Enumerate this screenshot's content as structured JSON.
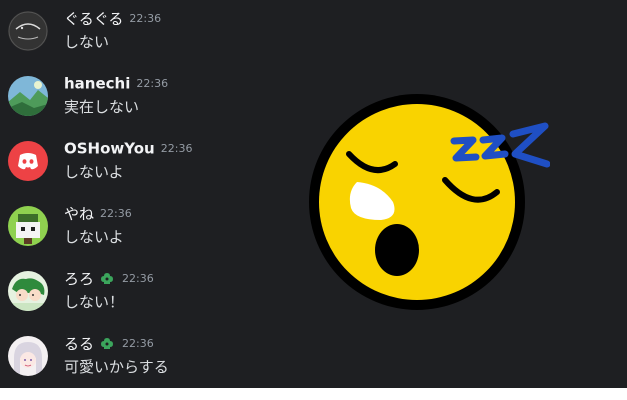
{
  "messages": [
    {
      "username": "ぐるぐる",
      "timestamp": "22:36",
      "text": "しない",
      "avatar_icon": "circle-doodle-avatar",
      "badge": false
    },
    {
      "username": "hanechi",
      "timestamp": "22:36",
      "text": "実在しない",
      "avatar_icon": "landscape-avatar",
      "badge": false
    },
    {
      "username": "OSHowYou",
      "timestamp": "22:36",
      "text": "しないよ",
      "avatar_icon": "discord-logo-avatar",
      "badge": false
    },
    {
      "username": "やね",
      "timestamp": "22:36",
      "text": "しないよ",
      "avatar_icon": "pixel-avatar",
      "badge": false
    },
    {
      "username": "ろろ",
      "timestamp": "22:36",
      "text": "しない！",
      "avatar_icon": "anime-avatar",
      "badge": true
    },
    {
      "username": "るる",
      "timestamp": "22:36",
      "text": "可愛いからする",
      "avatar_icon": "anime-girl-avatar",
      "badge": true
    }
  ],
  "large_emoji": {
    "name": "sleeping-face-emoji",
    "snore_text": "zzz"
  },
  "colors": {
    "background": "#1e1f22",
    "username": "#f2f3f5",
    "message": "#dbdee1",
    "timestamp": "#949ba4",
    "emoji_yellow": "#f9d300",
    "zzz_blue": "#1f4fc4",
    "badge_green": "#3ba55c",
    "discord_red": "#ed4245"
  }
}
